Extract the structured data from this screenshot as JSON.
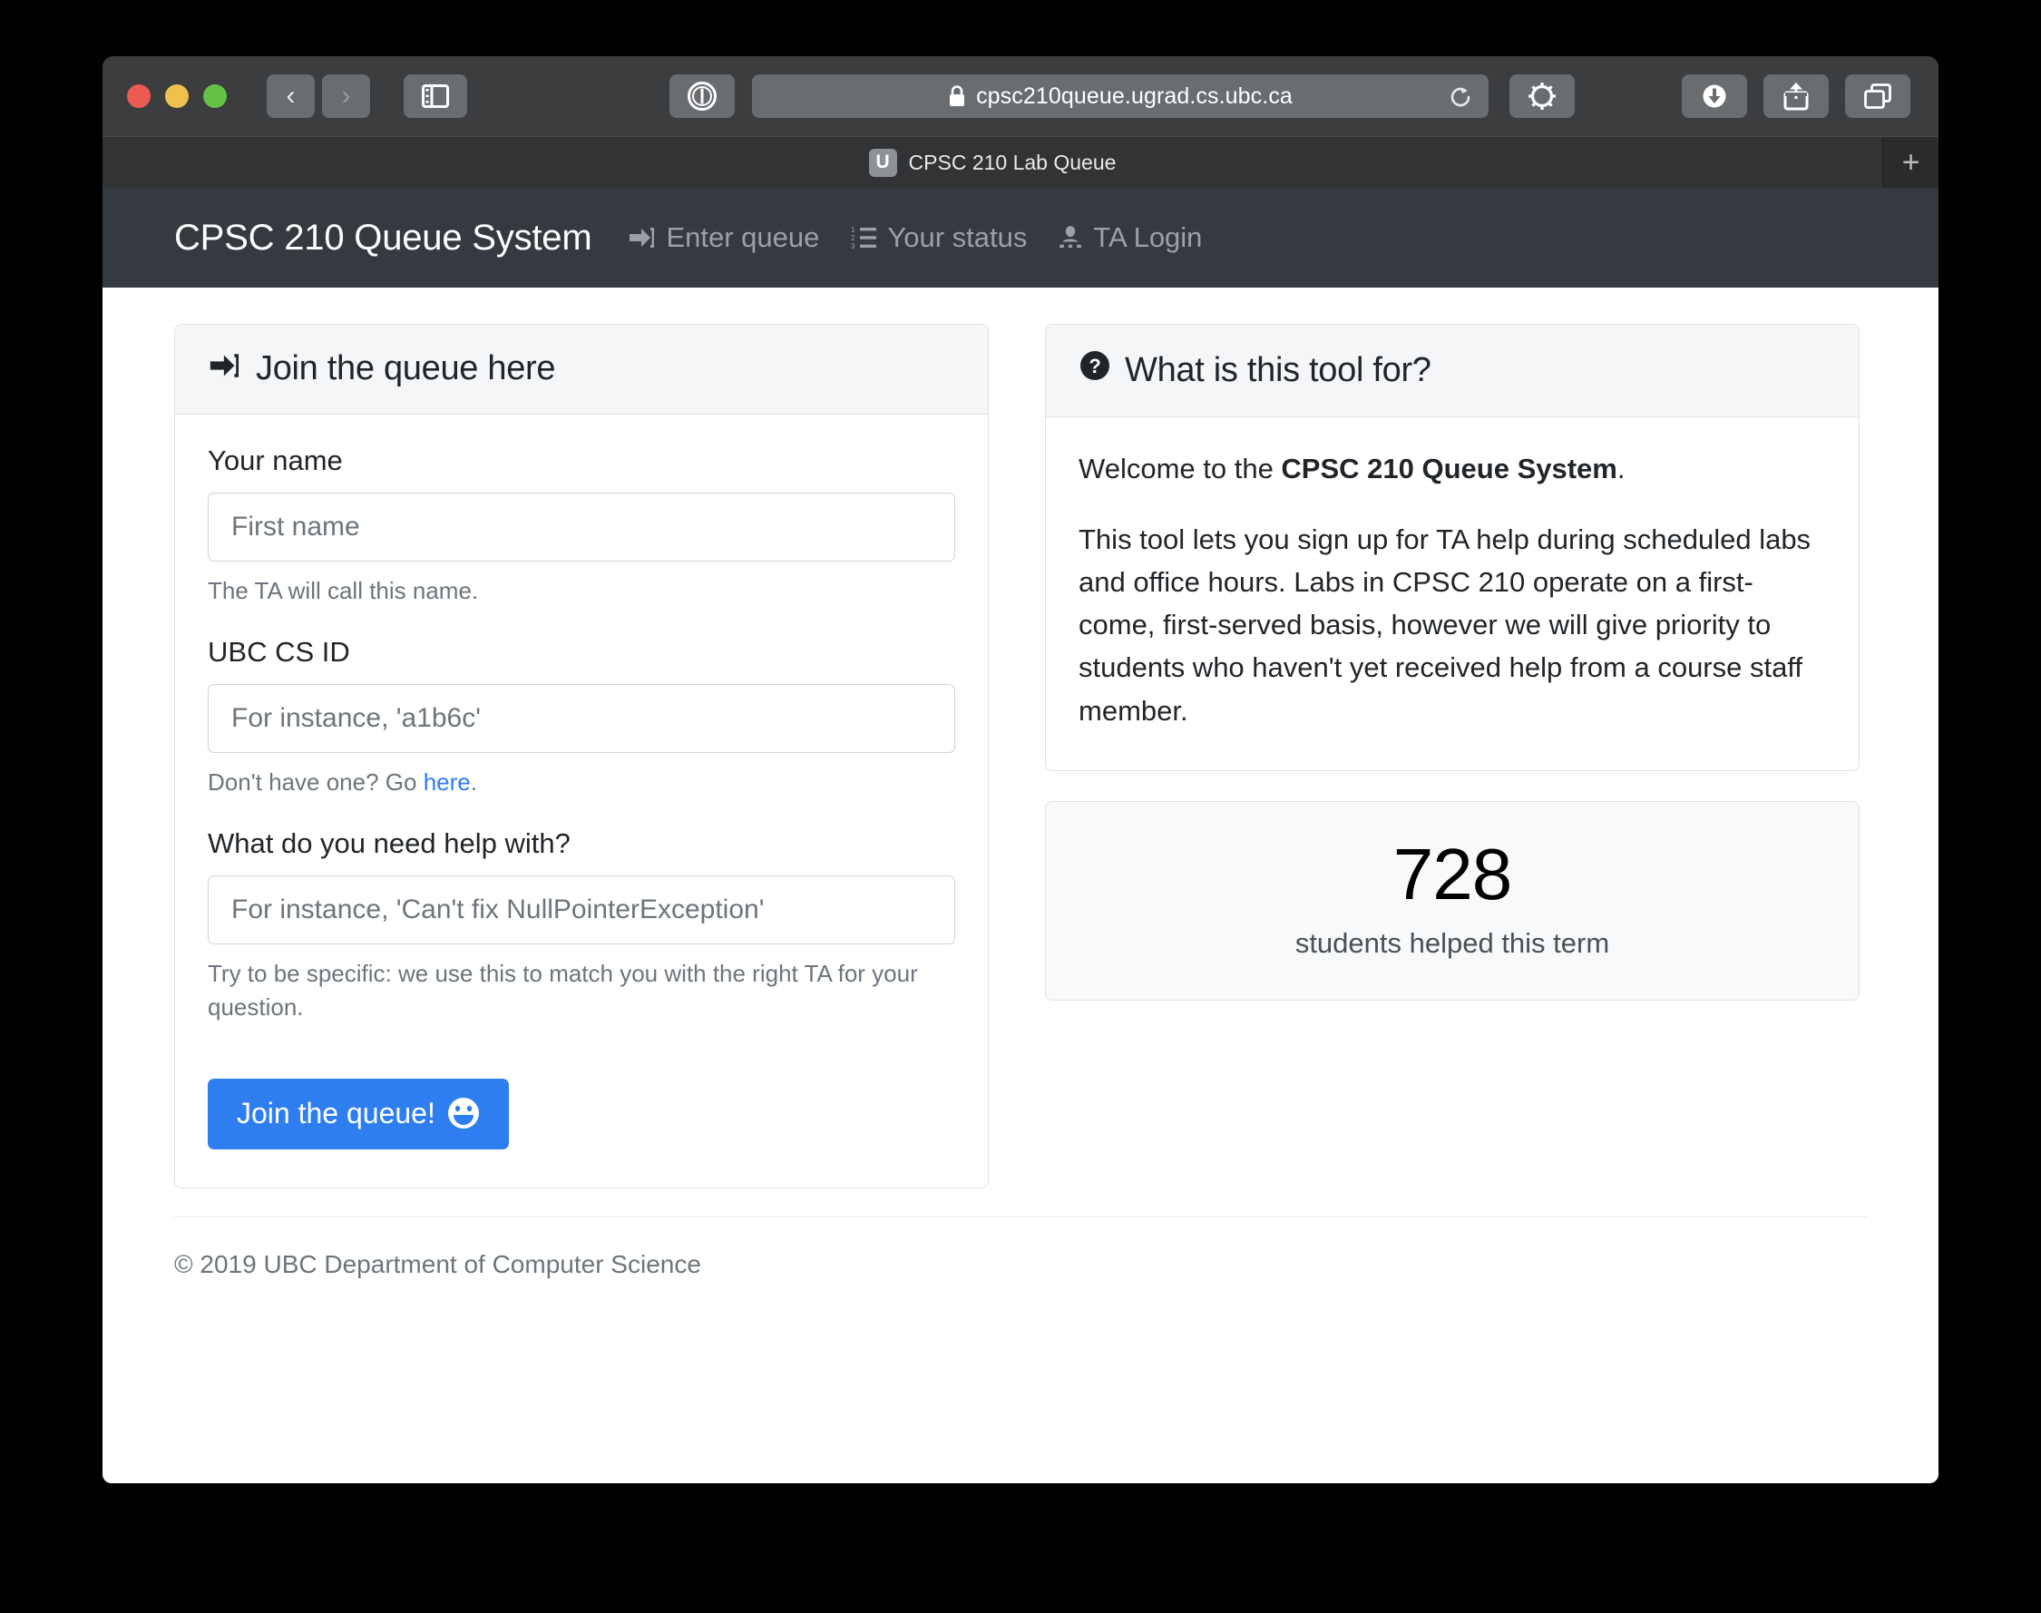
{
  "browser": {
    "url": "cpsc210queue.ugrad.cs.ubc.ca",
    "tab_title": "CPSC 210 Lab Queue",
    "favicon_letter": "U",
    "new_tab_label": "+",
    "back_label": "‹",
    "forward_label": "›",
    "icons": {
      "back": "chevron-left-icon",
      "forward": "chevron-right-icon",
      "sidebar": "sidebar-toggle-icon",
      "reader": "reader-view-icon",
      "lock": "lock-icon",
      "reload": "reload-icon",
      "gear": "gear-icon",
      "downloads": "download-icon",
      "share": "share-icon",
      "tabs": "tab-overview-icon"
    }
  },
  "navbar": {
    "brand": "CPSC 210 Queue System",
    "links": [
      {
        "label": "Enter queue",
        "icon": "sign-in-icon"
      },
      {
        "label": "Your status",
        "icon": "ordered-list-icon"
      },
      {
        "label": "TA Login",
        "icon": "user-secret-icon"
      }
    ]
  },
  "join_card": {
    "title": "Join the queue here",
    "title_icon": "sign-in-icon",
    "name": {
      "label": "Your name",
      "placeholder": "First name",
      "value": "",
      "help": "The TA will call this name."
    },
    "cs_id": {
      "label": "UBC CS ID",
      "placeholder": "For instance, 'a1b6c'",
      "value": "",
      "help_before": "Don't have one? Go ",
      "help_link": "here",
      "help_after": "."
    },
    "question": {
      "label": "What do you need help with?",
      "placeholder": "For instance, 'Can't fix NullPointerException'",
      "value": "",
      "help": "Try to be specific: we use this to match you with the right TA for your question."
    },
    "submit_label": "Join the queue!",
    "submit_emoji": "grinning-smile-emoji",
    "submit_color": "#2e7ef0"
  },
  "info_card": {
    "title": "What is this tool for?",
    "title_icon": "question-circle-icon",
    "welcome_before": "Welcome to the ",
    "welcome_bold": "CPSC 210 Queue System",
    "welcome_after": ".",
    "paragraph": "This tool lets you sign up for TA help during scheduled labs and office hours. Labs in CPSC 210 operate on a first-come, first-served basis, however we will give priority to students who haven't yet received help from a course staff member."
  },
  "stat_card": {
    "number": "728",
    "label": "students helped this term"
  },
  "footer": {
    "text": "© 2019 UBC Department of Computer Science"
  }
}
